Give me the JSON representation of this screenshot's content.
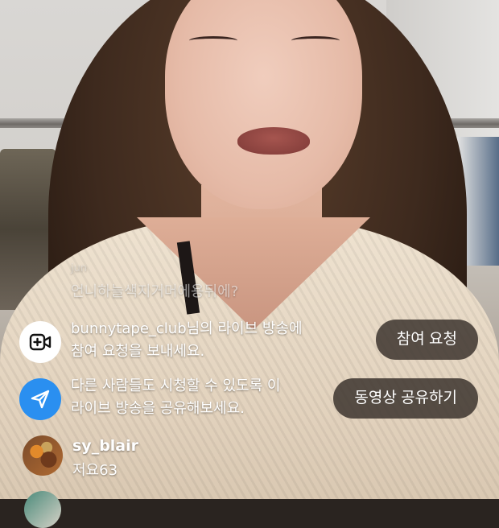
{
  "overlay": {
    "faded_comment": "언니하늘색지거머에용뒤에?",
    "faded_comment_above": "jun",
    "notices": [
      {
        "icon": "video-plus-icon",
        "text_line1": "bunnytape_club님의 라이브 방송에",
        "text_line2": "참여 요청을 보내세요.",
        "button": "참여 요청"
      },
      {
        "icon": "send-icon",
        "text_line1": "다른 사람들도 시청할 수 있도록 이",
        "text_line2": "라이브 방송을 공유해보세요.",
        "button": "동영상 공유하기"
      }
    ],
    "comment": {
      "username": "sy_blair",
      "text": "저요63"
    }
  },
  "colors": {
    "share_icon_bg": "#2a8ff0",
    "pill_bg": "#3c342e",
    "text": "#ffffff"
  }
}
